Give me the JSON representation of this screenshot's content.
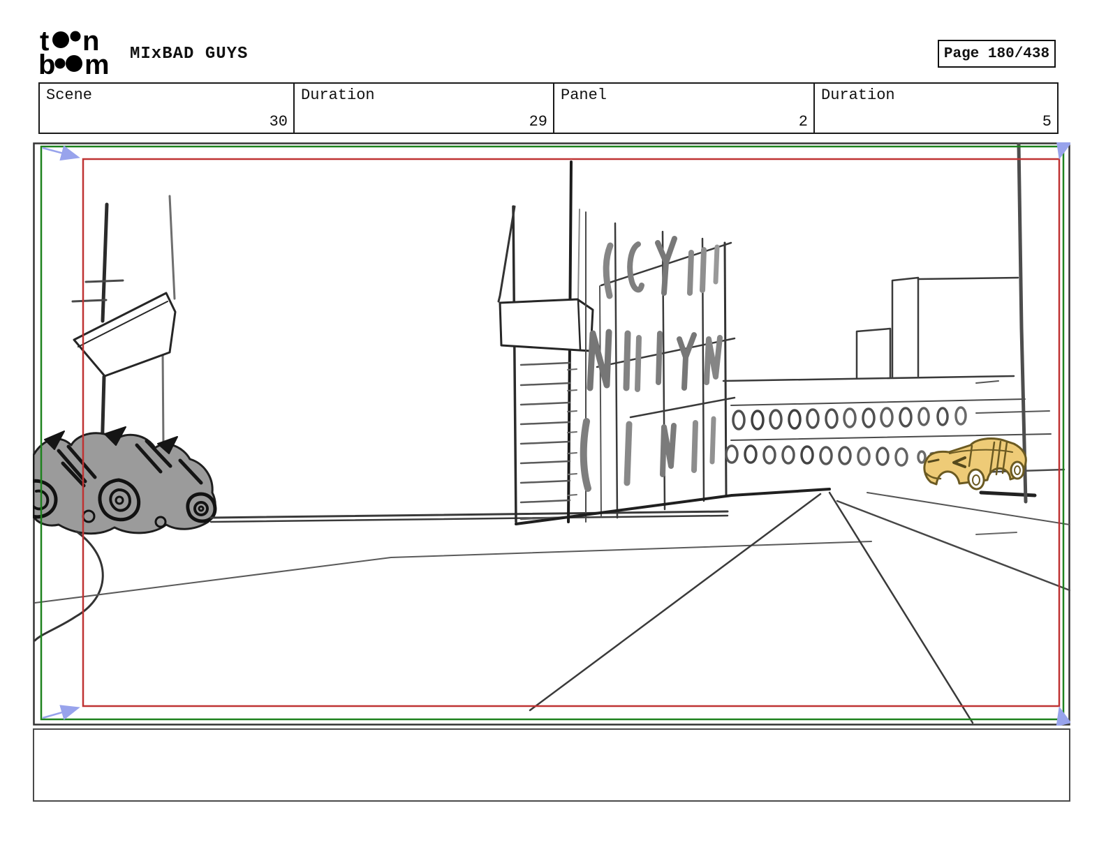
{
  "header": {
    "logo": {
      "l1a": "t",
      "l1b": "n",
      "l2a": "b",
      "l2b": "m"
    },
    "title": "MIxBAD GUYS",
    "page_label": "Page 180/438"
  },
  "info_table": {
    "cells": [
      {
        "label": "Scene",
        "value": "30"
      },
      {
        "label": "Duration",
        "value": "29"
      },
      {
        "label": "Panel",
        "value": "2"
      },
      {
        "label": "Duration",
        "value": "5"
      }
    ]
  },
  "panel": {
    "caption": "",
    "colors": {
      "camera_start_frame": "#1e821e",
      "camera_end_frame": "#bf3333",
      "camera_arrow": "#98a3ec",
      "taxi_fill": "#eecb77",
      "taxi_outline": "#6b5a22",
      "pile_fill": "#9b9b9b"
    }
  }
}
